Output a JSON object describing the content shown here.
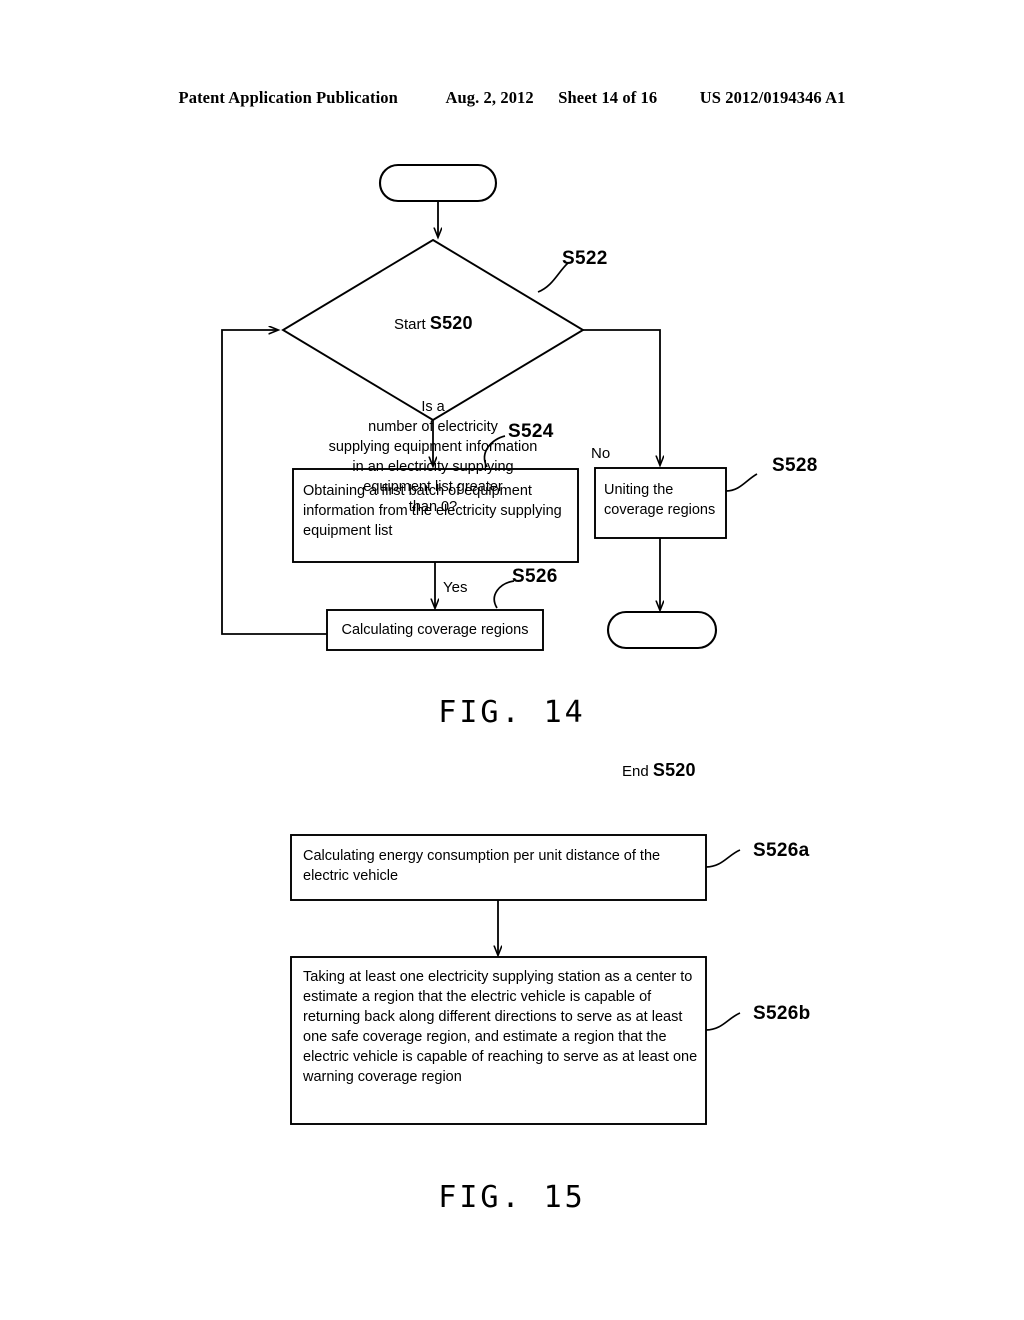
{
  "header": {
    "publication": "Patent Application Publication",
    "date": "Aug. 2, 2012",
    "sheet": "Sheet 14 of 16",
    "docnum": "US 2012/0194346 A1"
  },
  "fig14": {
    "caption": "FIG. 14",
    "start": {
      "label": "Start",
      "step": "S520"
    },
    "end": {
      "label": "End",
      "step": "S520"
    },
    "decision": {
      "ref": "S522",
      "text": "Is a\nnumber of electricity\nsupplying equipment information\nin an electricity supplying\nequipment list greater\nthan 0?"
    },
    "branch_yes": "Yes",
    "branch_no": "No",
    "step_s524": {
      "ref": "S524",
      "text": "Obtaining a first batch of equipment information from the electricity supplying equipment list"
    },
    "step_s526": {
      "ref": "S526",
      "text": "Calculating coverage regions"
    },
    "step_s528": {
      "ref": "S528",
      "text": "Uniting the\ncoverage regions"
    }
  },
  "fig15": {
    "caption": "FIG. 15",
    "step_s526a": {
      "ref": "S526a",
      "text": "Calculating energy consumption per unit distance of the electric vehicle"
    },
    "step_s526b": {
      "ref": "S526b",
      "text": "Taking at least one electricity supplying station as a center to estimate a region that the electric vehicle is capable of returning back along different directions to serve as at least one safe coverage region, and estimate a region that the electric vehicle is capable of reaching to serve as at least one warning coverage region"
    }
  },
  "colors": {
    "ink": "#000000",
    "paper": "#ffffff"
  }
}
